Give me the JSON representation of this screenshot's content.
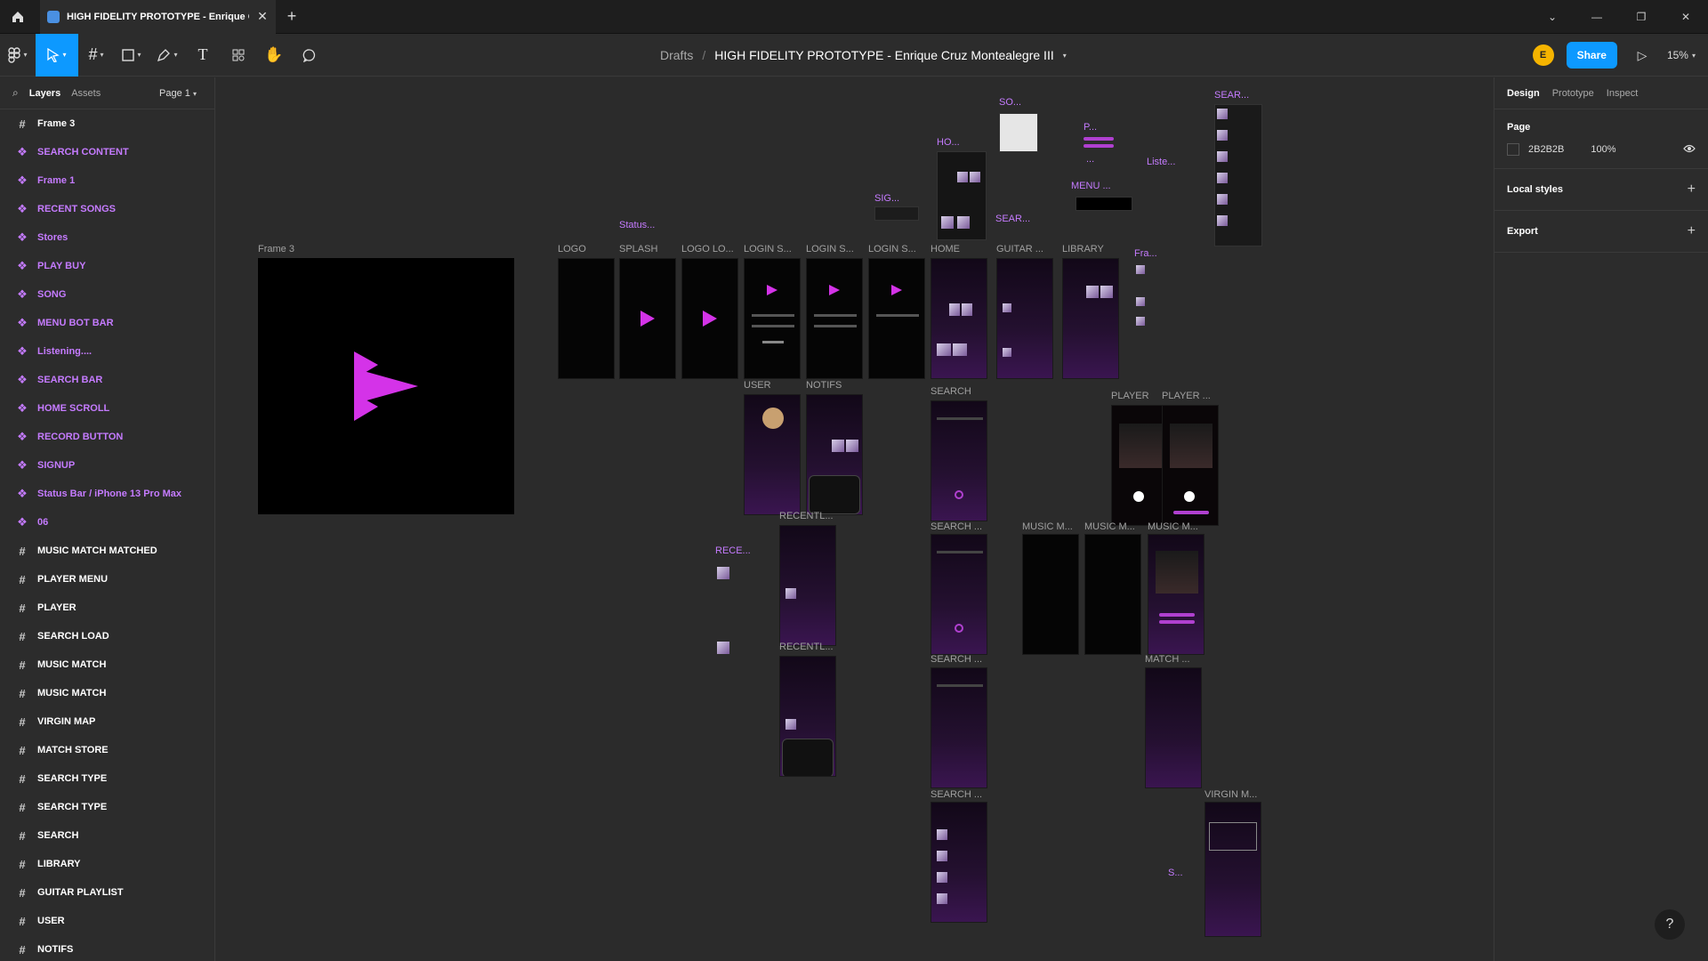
{
  "tab": {
    "title": "HIGH FIDELITY PROTOTYPE - Enrique C",
    "close": "✕",
    "new": "+"
  },
  "window": {
    "min": "—",
    "restore": "❐",
    "close": "✕",
    "menu": "⌄"
  },
  "breadcrumb": {
    "drafts": "Drafts",
    "sep": "/",
    "title": "HIGH FIDELITY PROTOTYPE - Enrique Cruz Montealegre III"
  },
  "toolbar": {
    "avatar": "E",
    "share": "Share",
    "zoom": "15%"
  },
  "left_panel": {
    "tabs": [
      "Layers",
      "Assets"
    ],
    "page": "Page 1",
    "layers": [
      {
        "name": "Frame 3",
        "kind": "frame"
      },
      {
        "name": "SEARCH CONTENT",
        "kind": "comp"
      },
      {
        "name": "Frame 1",
        "kind": "comp"
      },
      {
        "name": "RECENT SONGS",
        "kind": "comp"
      },
      {
        "name": "Stores",
        "kind": "comp"
      },
      {
        "name": "PLAY BUY",
        "kind": "comp"
      },
      {
        "name": "SONG",
        "kind": "comp"
      },
      {
        "name": "MENU BOT BAR",
        "kind": "comp"
      },
      {
        "name": "Listening....",
        "kind": "comp"
      },
      {
        "name": "SEARCH BAR",
        "kind": "comp"
      },
      {
        "name": "HOME SCROLL",
        "kind": "comp"
      },
      {
        "name": "RECORD BUTTON",
        "kind": "comp"
      },
      {
        "name": "SIGNUP",
        "kind": "comp"
      },
      {
        "name": "Status Bar / iPhone 13 Pro Max",
        "kind": "comp"
      },
      {
        "name": "06",
        "kind": "comp"
      },
      {
        "name": "MUSIC MATCH MATCHED",
        "kind": "frame"
      },
      {
        "name": "PLAYER MENU",
        "kind": "frame"
      },
      {
        "name": "PLAYER",
        "kind": "frame"
      },
      {
        "name": "SEARCH LOAD",
        "kind": "frame"
      },
      {
        "name": "MUSIC MATCH",
        "kind": "frame"
      },
      {
        "name": "MUSIC MATCH",
        "kind": "frame"
      },
      {
        "name": "VIRGIN MAP",
        "kind": "frame"
      },
      {
        "name": "MATCH STORE",
        "kind": "frame"
      },
      {
        "name": "SEARCH TYPE",
        "kind": "frame"
      },
      {
        "name": "SEARCH TYPE",
        "kind": "frame"
      },
      {
        "name": "SEARCH",
        "kind": "frame"
      },
      {
        "name": "LIBRARY",
        "kind": "frame"
      },
      {
        "name": "GUITAR PLAYLIST",
        "kind": "frame"
      },
      {
        "name": "USER",
        "kind": "frame"
      },
      {
        "name": "NOTIFS",
        "kind": "frame"
      }
    ]
  },
  "canvas": {
    "frame_labels": {
      "frame3": "Frame 3",
      "logo": "LOGO",
      "splash": "SPLASH",
      "logolo": "LOGO LO...",
      "login1": "LOGIN S...",
      "login2": "LOGIN S...",
      "login3": "LOGIN S...",
      "home": "HOME",
      "guitar": "GUITAR ...",
      "library": "LIBRARY",
      "user": "USER",
      "notifs": "NOTIFS",
      "search1": "SEARCH",
      "search2": "SEARCH ...",
      "search3": "SEARCH ...",
      "search4": "SEARCH ...",
      "player1": "PLAYER",
      "player2": "PLAYER ...",
      "recentl1": "RECENTL...",
      "recentl2": "RECENTL...",
      "mm1": "MUSIC M...",
      "mm2": "MUSIC M...",
      "mm3": "MUSIC M...",
      "match": "MATCH ...",
      "virgin": "VIRGIN M..."
    },
    "comp_labels": {
      "status": "Status...",
      "sig": "SIG...",
      "ho": "HO...",
      "so": "SO...",
      "sear1": "SEAR...",
      "p": "P...",
      "dots": "...",
      "menu": "MENU ...",
      "liste": "Liste...",
      "sear2": "SEAR...",
      "fra": "Fra...",
      "rece": "RECE...",
      "s": "S..."
    }
  },
  "right_panel": {
    "tabs": [
      "Design",
      "Prototype",
      "Inspect"
    ],
    "page_title": "Page",
    "page_color": "2B2B2B",
    "page_opacity": "100%",
    "local_styles": "Local styles",
    "export": "Export",
    "plus": "+"
  },
  "help": "?",
  "colors": {
    "accent": "#0d99ff",
    "component": "#c57bff",
    "logo": "#d433e8"
  }
}
